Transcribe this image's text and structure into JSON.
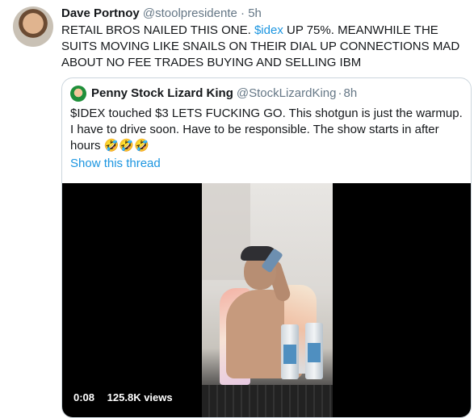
{
  "tweet": {
    "author_name": "Dave Portnoy",
    "author_handle": "@stoolpresidente",
    "separator": "·",
    "time": "5h",
    "text_part1": "RETAIL BROS NAILED THIS ONE.  ",
    "cashtag": "$idex",
    "text_part2": " UP 75%.   MEANWHILE THE SUITS MOVING LIKE SNAILS ON THEIR DIAL UP CONNECTIONS MAD ABOUT NO FEE TRADES BUYING AND SELLING IBM"
  },
  "quoted_tweet": {
    "author_name": "Penny Stock Lizard King",
    "author_handle": "@StockLizardKing",
    "separator": "·",
    "time": "8h",
    "text": "$IDEX touched $3 LETS FUCKING GO. This shotgun is just the warmup. I have to drive soon. Have to be responsible. The show starts in after hours 🤣🤣🤣",
    "show_thread_label": "Show this thread",
    "video": {
      "duration": "0:08",
      "views": "125.8K views"
    }
  },
  "colors": {
    "link": "#1b95e0",
    "text_primary": "#14171a",
    "text_secondary": "#657786",
    "border": "#ccd6dd"
  }
}
